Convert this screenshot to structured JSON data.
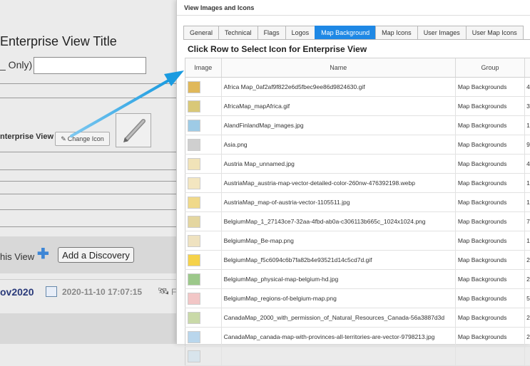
{
  "background": {
    "title": "Enterprise View Title",
    "only_text": "_ Only)",
    "icon_label": "nterprise View",
    "change_icon_label": "Change Icon",
    "view_text": "his View",
    "add_discovery_label": "Add a Discovery",
    "ov_text": "ov2020",
    "datetime": "2020-11-10 17:07:15",
    "p_char": "F"
  },
  "dialog": {
    "title": "View Images and Icons",
    "tabs": [
      {
        "label": "General"
      },
      {
        "label": "Technical"
      },
      {
        "label": "Flags"
      },
      {
        "label": "Logos"
      },
      {
        "label": "Map Background"
      },
      {
        "label": "Map Icons"
      },
      {
        "label": "User Images"
      },
      {
        "label": "User Map Icons"
      }
    ],
    "active_tab": "Map Background",
    "instruction": "Click Row to Select Icon for Enterprise View",
    "columns": {
      "image": "Image",
      "name": "Name",
      "group": "Group"
    },
    "rows": [
      {
        "name": "Africa Map_0af2af9f822e6d5fbec9ee86d9824630.gif",
        "group": "Map Backgrounds",
        "extra": "4",
        "thumb_color": "#e0b85a"
      },
      {
        "name": "AfricaMap_mapAfrica.gif",
        "group": "Map Backgrounds",
        "extra": "3",
        "thumb_color": "#d9c878"
      },
      {
        "name": "AlandFinlandMap_images.jpg",
        "group": "Map Backgrounds",
        "extra": "1",
        "thumb_color": "#9ecbe6"
      },
      {
        "name": "Asia.png",
        "group": "Map Backgrounds",
        "extra": "9",
        "thumb_color": "#cfcfcf"
      },
      {
        "name": "Austria Map_unnamed.jpg",
        "group": "Map Backgrounds",
        "extra": "4",
        "thumb_color": "#f1e3b8"
      },
      {
        "name": "AustriaMap_austria-map-vector-detailed-color-260nw-476392198.webp",
        "group": "Map Backgrounds",
        "extra": "1",
        "thumb_color": "#f3e6c0"
      },
      {
        "name": "AustriaMap_map-of-austria-vector-1105511.jpg",
        "group": "Map Backgrounds",
        "extra": "1",
        "thumb_color": "#f0d98a"
      },
      {
        "name": "BelgiumMap_1_27143ce7-32aa-4fbd-ab0a-c306113b665c_1024x1024.png",
        "group": "Map Backgrounds",
        "extra": "7",
        "thumb_color": "#e4d6a0"
      },
      {
        "name": "BelgiumMap_Be-map.png",
        "group": "Map Backgrounds",
        "extra": "1",
        "thumb_color": "#efe2c0"
      },
      {
        "name": "BelgiumMap_f5c6094c6b7fa82b4e93521d14c5cd7d.gif",
        "group": "Map Backgrounds",
        "extra": "2",
        "thumb_color": "#f5d24a"
      },
      {
        "name": "BelgiumMap_physical-map-belgium-hd.jpg",
        "group": "Map Backgrounds",
        "extra": "2",
        "thumb_color": "#9cc88a"
      },
      {
        "name": "BelgiumMap_regions-of-belgium-map.png",
        "group": "Map Backgrounds",
        "extra": "5",
        "thumb_color": "#f2c6c6"
      },
      {
        "name": "CanadaMap_2000_with_permission_of_Natural_Resources_Canada-56a3887d3d",
        "group": "Map Backgrounds",
        "extra": "2",
        "thumb_color": "#c9d9a8"
      },
      {
        "name": "CanadaMap_canada-map-with-provinces-all-territories-are-vector-9798213.jpg",
        "group": "Map Backgrounds",
        "extra": "2",
        "thumb_color": "#b9d6ec"
      },
      {
        "name": "",
        "group": "",
        "extra": "",
        "thumb_color": "#d8e4ec"
      }
    ]
  }
}
